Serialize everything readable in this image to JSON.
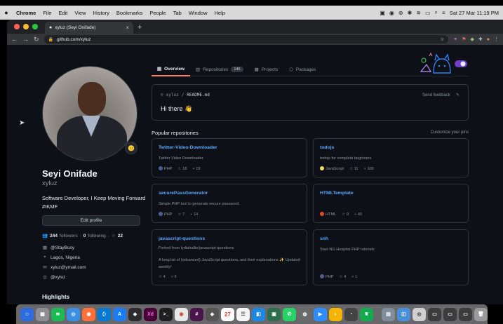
{
  "menubar": {
    "apple": "",
    "items": [
      "Chrome",
      "File",
      "Edit",
      "View",
      "History",
      "Bookmarks",
      "People",
      "Tab",
      "Window",
      "Help"
    ],
    "clock": "Sat 27 Mar  11:19 PM"
  },
  "browser": {
    "tab_title": "xyluz (Seyi Onifade)",
    "url": "github.com/xyluz",
    "new_tab": "+"
  },
  "profile": {
    "full_name": "Seyi Onifade",
    "login": "xyluz",
    "bio": "Software Developer, I Keep Moving Forward #IKMF",
    "edit_profile": "Edit profile",
    "followers_count": "244",
    "followers_label": "followers",
    "following_count": "0",
    "following_label": "following",
    "stars_count": "22",
    "status": "@StayBusy",
    "location": "Lagos, Nigeria",
    "email": "xyluz@ymail.com",
    "twitter": "@xyluz",
    "highlights": "Highlights",
    "status_emoji": "😐"
  },
  "nav": {
    "overview": "Overview",
    "repositories": "Repositories",
    "repositories_count": "146",
    "projects": "Projects",
    "packages": "Packages"
  },
  "readme": {
    "owner": "xyluz",
    "file": "README.md",
    "send_feedback": "Send feedback",
    "greeting": "Hi there 👋"
  },
  "popular": {
    "title": "Popular repositories",
    "customize": "Customize your pins",
    "repos": [
      {
        "name": "Twitter-Video-Downloader",
        "desc": "Twitter Video Downloader",
        "lang": "PHP",
        "lang_color": "#4F5D95",
        "stars": "18",
        "forks": "19"
      },
      {
        "name": "todojs",
        "desc": "todojs for complete beginners",
        "lang": "JavaScript",
        "lang_color": "#f1e05a",
        "stars": "11",
        "forks": "100"
      },
      {
        "name": "securePassGenerator",
        "desc": "Simple PHP tool to generate secure password",
        "lang": "PHP",
        "lang_color": "#4F5D95",
        "stars": "7",
        "forks": "14"
      },
      {
        "name": "HTMLTemplate",
        "desc": "",
        "lang": "HTML",
        "lang_color": "#e34c26",
        "stars": "9",
        "forks": "45"
      },
      {
        "name": "javascript-questions",
        "desc": "Forked from lydiahallie/javascript-questions",
        "desc2": "A long list of (advanced) JavaScript questions, and their explanations ✨ Updated weekly!",
        "lang": "",
        "lang_color": "",
        "stars": "4",
        "forks": "6"
      },
      {
        "name": "snh",
        "desc": "Start NG Hospital PHP tutorials",
        "lang": "PHP",
        "lang_color": "#4F5D95",
        "stars": "4",
        "forks": "1"
      }
    ]
  },
  "dock": {
    "calendar_date": "27",
    "xd_label": "Xd"
  }
}
